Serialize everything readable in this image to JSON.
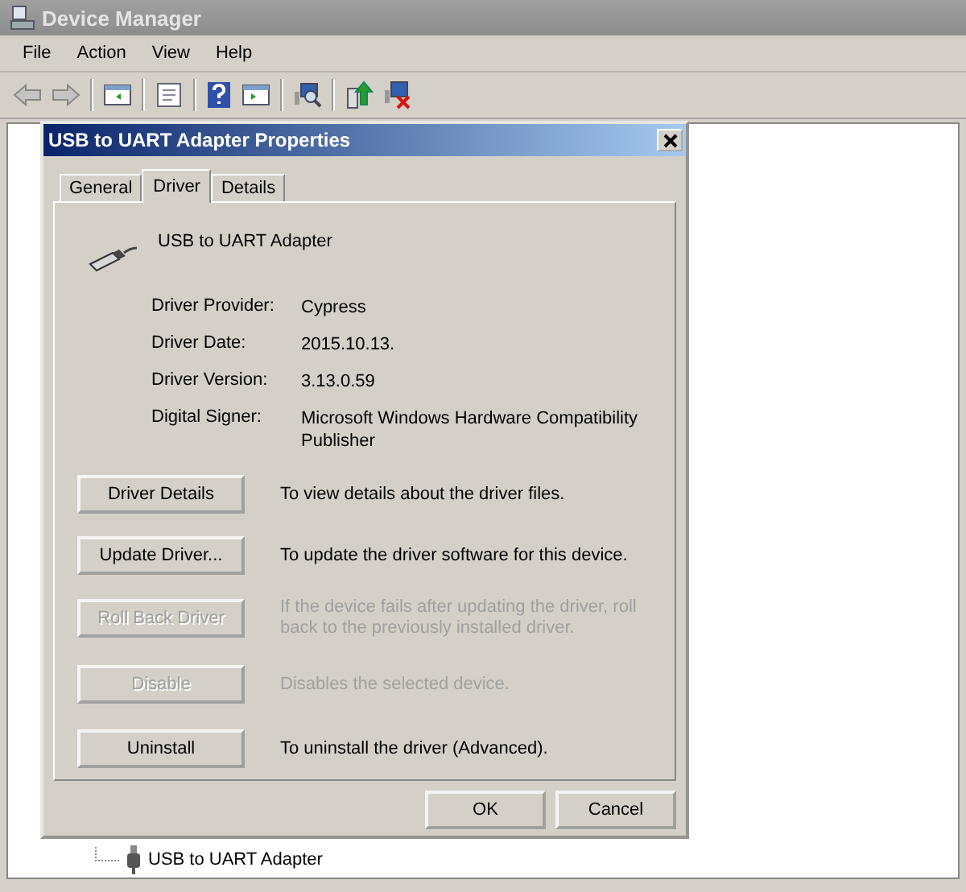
{
  "window": {
    "title": "Device Manager"
  },
  "menu": [
    "File",
    "Action",
    "View",
    "Help"
  ],
  "toolbar": [
    {
      "kind": "back",
      "disabled": true
    },
    {
      "kind": "forward",
      "disabled": true
    },
    {
      "kind": "sep"
    },
    {
      "kind": "tree"
    },
    {
      "kind": "sep"
    },
    {
      "kind": "props"
    },
    {
      "kind": "sep"
    },
    {
      "kind": "help"
    },
    {
      "kind": "pane"
    },
    {
      "kind": "sep"
    },
    {
      "kind": "scan"
    },
    {
      "kind": "sep"
    },
    {
      "kind": "update"
    },
    {
      "kind": "uninstall"
    }
  ],
  "tree_item": {
    "label": "USB to UART Adapter"
  },
  "dialog": {
    "title": "USB to UART Adapter Properties",
    "tabs": [
      {
        "label": "General",
        "selected": false
      },
      {
        "label": "Driver",
        "selected": true
      },
      {
        "label": "Details",
        "selected": false
      }
    ],
    "device_name": "USB to UART Adapter",
    "properties": [
      {
        "label": "Driver Provider:",
        "value": "Cypress"
      },
      {
        "label": "Driver Date:",
        "value": "2015.10.13."
      },
      {
        "label": "Driver Version:",
        "value": "3.13.0.59"
      },
      {
        "label": "Digital Signer:",
        "value": "Microsoft Windows Hardware Compatibility Publisher"
      }
    ],
    "actions": [
      {
        "label": "Driver Details",
        "description": "To view details about the driver files.",
        "disabled": false
      },
      {
        "label": "Update Driver...",
        "description": "To update the driver software for this device.",
        "disabled": false
      },
      {
        "label": "Roll Back Driver",
        "description": "If the device fails after updating the driver, roll back to the previously installed driver.",
        "disabled": true
      },
      {
        "label": "Disable",
        "description": "Disables the selected device.",
        "disabled": true
      },
      {
        "label": "Uninstall",
        "description": "To uninstall the driver (Advanced).",
        "disabled": false
      }
    ],
    "buttons": [
      "OK",
      "Cancel"
    ]
  }
}
